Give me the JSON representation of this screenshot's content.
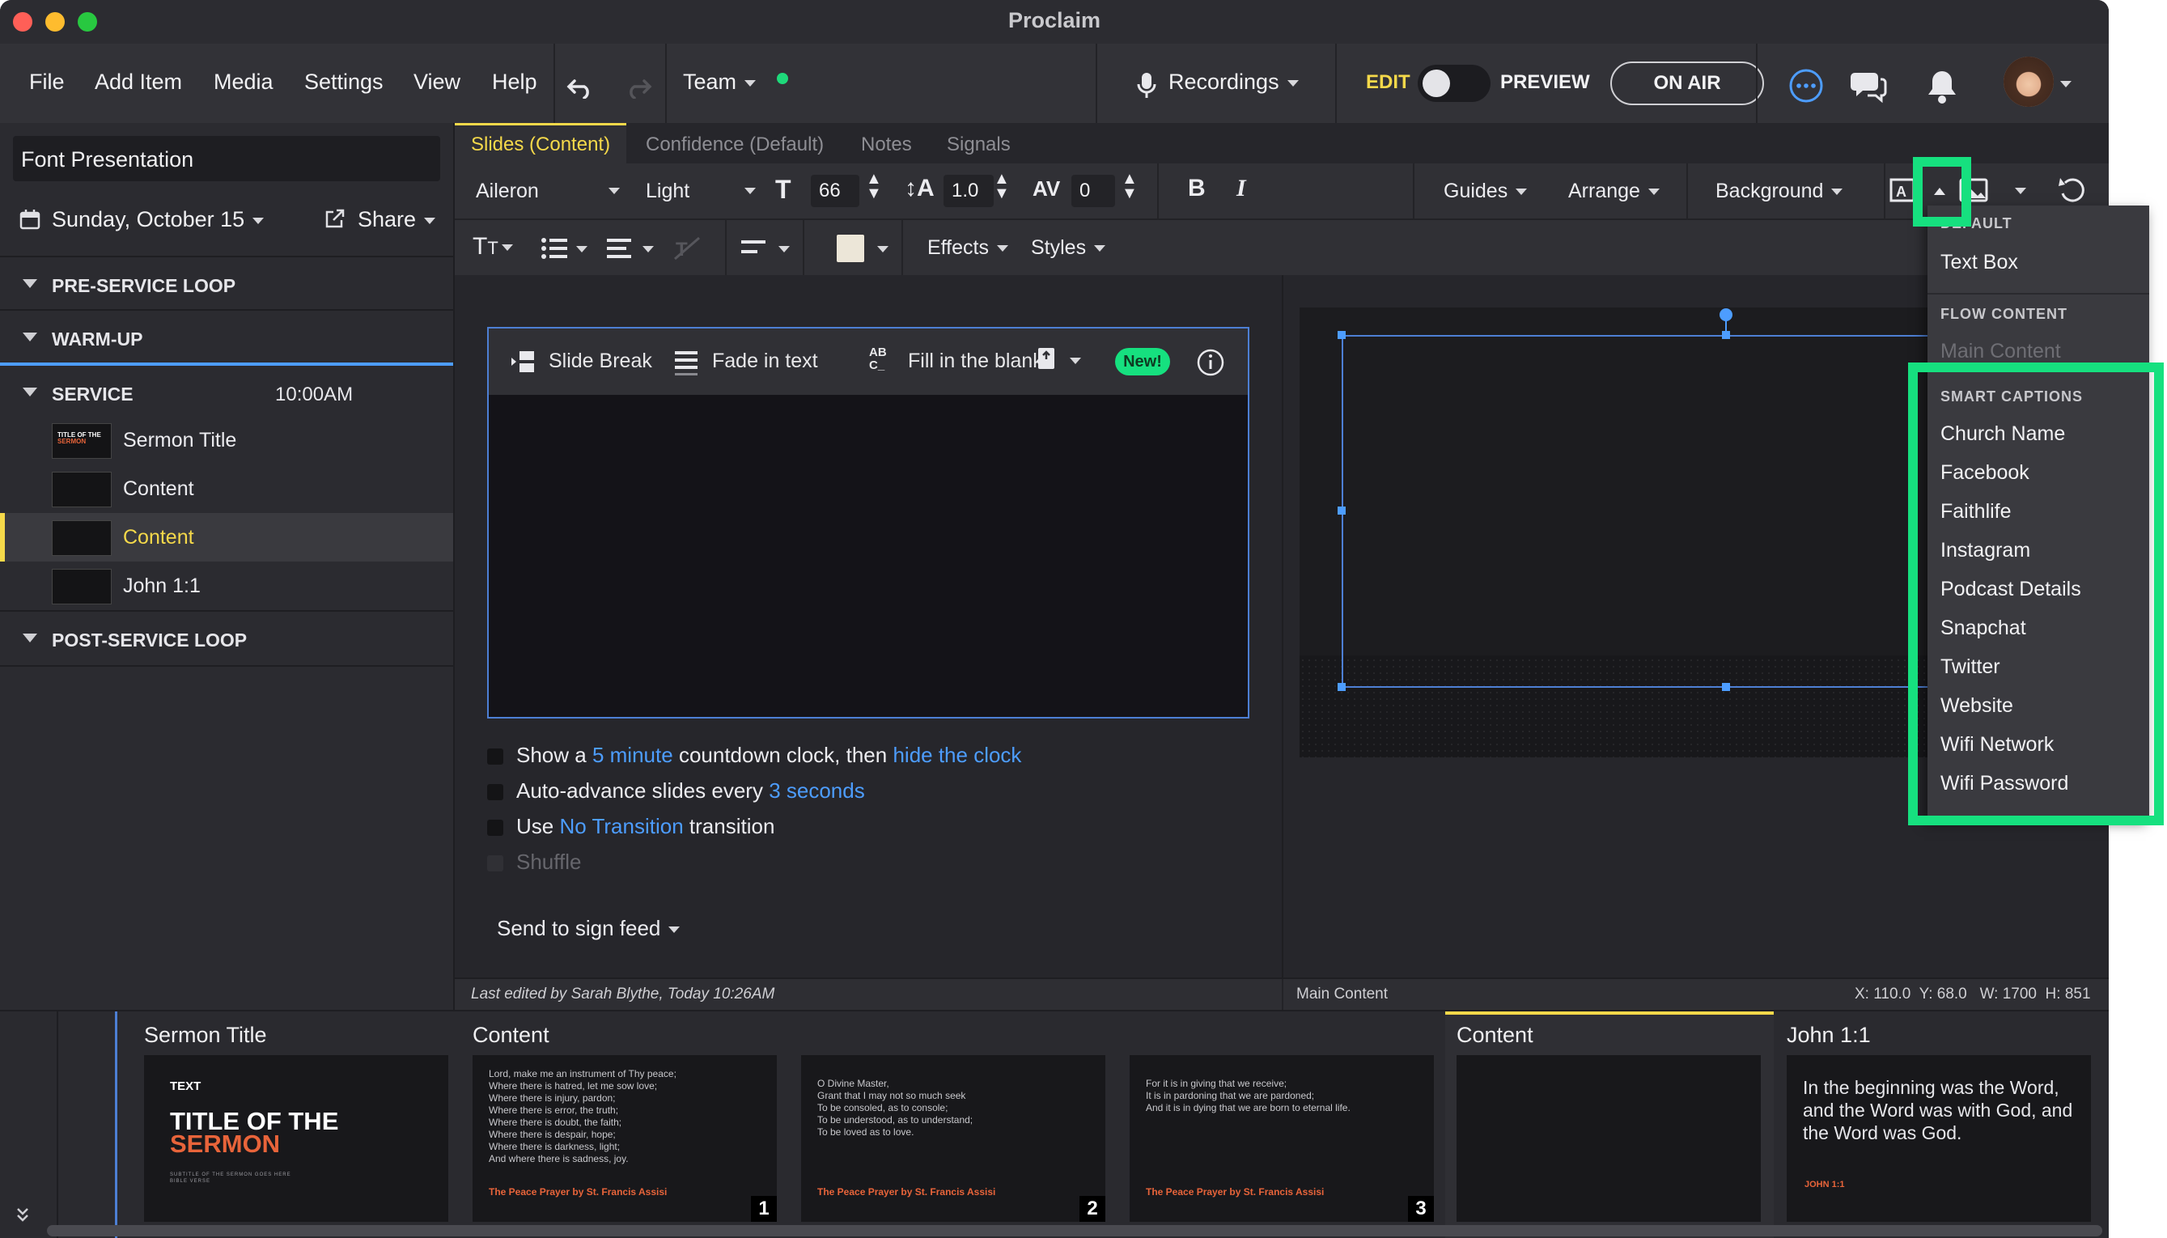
{
  "app": {
    "title": "Proclaim"
  },
  "menu": [
    "File",
    "Add Item",
    "Media",
    "Settings",
    "View",
    "Help"
  ],
  "header": {
    "team_label": "Team",
    "recordings_label": "Recordings",
    "edit_label": "EDIT",
    "preview_label": "PREVIEW",
    "on_air_label": "ON AIR"
  },
  "colors": {
    "accent": "#f5d94a",
    "link": "#4d9dff",
    "highlight": "#16e07f",
    "online": "#1ed97a",
    "sermon_orange": "#e8643a"
  },
  "sidebar": {
    "presentation_title": "Font Presentation",
    "date": "Sunday, October 15",
    "share_label": "Share",
    "sections": [
      {
        "label": "PRE-SERVICE LOOP"
      },
      {
        "label": "WARM-UP"
      },
      {
        "label": "SERVICE",
        "time": "10:00AM"
      },
      {
        "label": "POST-SERVICE LOOP"
      }
    ],
    "items": [
      {
        "label": "Sermon Title"
      },
      {
        "label": "Content"
      },
      {
        "label": "Content",
        "selected": true
      },
      {
        "label": "John 1:1"
      }
    ]
  },
  "tabs": [
    "Slides (Content)",
    "Confidence (Default)",
    "Notes",
    "Signals"
  ],
  "format": {
    "font": "Aileron",
    "weight": "Light",
    "size": "66",
    "line_height": "1.0",
    "spacing": "0",
    "bold": "B",
    "italic": "I",
    "guides": "Guides",
    "arrange": "Arrange",
    "background": "Background",
    "effects": "Effects",
    "styles": "Styles"
  },
  "editor": {
    "slide_break": "Slide Break",
    "fade_in_text": "Fade in text",
    "fill_blank": "Fill in the blank",
    "new_badge": "New!",
    "options": {
      "show_a": "Show a",
      "five_minute": "5 minute",
      "countdown": "countdown clock, then",
      "hide_clock": "hide the clock",
      "auto_advance": "Auto-advance slides every",
      "three_seconds": "3 seconds",
      "use": "Use",
      "no_transition": "No Transition",
      "transition": "transition",
      "shuffle": "Shuffle"
    },
    "send_to_sign": "Send to sign feed"
  },
  "status": {
    "last_edited": "Last edited by Sarah Blythe, Today 10:26AM",
    "layer": "Main Content",
    "coords": "X: 110.0  Y: 68.0   W: 1700  H: 851"
  },
  "dropdown": {
    "default_head": "DEFAULT",
    "default_items": [
      "Text Box"
    ],
    "flow_head": "FLOW CONTENT",
    "flow_items": [
      "Main Content"
    ],
    "smart_head": "SMART CAPTIONS",
    "smart_items": [
      "Church Name",
      "Facebook",
      "Faithlife",
      "Instagram",
      "Podcast Details",
      "Snapchat",
      "Twitter",
      "Website",
      "Wifi Network",
      "Wifi Password"
    ]
  },
  "strip": {
    "cards": [
      {
        "title": "Sermon Title",
        "small": "TEXT",
        "big1": "TITLE OF THE",
        "big2": "SERMON",
        "sub": "SUBTITLE OF THE SERMON GOES HERE\nBIBLE VERSE"
      },
      {
        "title": "Content",
        "text": "Lord, make me an instrument of Thy peace;\nWhere there is hatred, let me sow love;\nWhere there is injury, pardon;\nWhere there is error, the truth;\nWhere there is doubt, the faith;\nWhere there is despair, hope;\nWhere there is darkness, light;\nAnd where there is sadness, joy.",
        "foot": "The Peace Prayer by St. Francis Assisi",
        "badge": "1"
      },
      {
        "title": "",
        "text": "O Divine Master,\nGrant that I may not so much seek\nTo be consoled, as to console;\nTo be understood, as to understand;\nTo be loved as to love.",
        "foot": "The Peace Prayer by St. Francis Assisi",
        "badge": "2"
      },
      {
        "title": "",
        "text": "For it is in giving that we receive;\nIt is in pardoning that we are pardoned;\nAnd it is in dying that we are born to eternal life.",
        "foot": "The Peace Prayer by St. Francis Assisi",
        "badge": "3"
      },
      {
        "title": "Content"
      },
      {
        "title": "John 1:1",
        "text": "In the beginning was the Word,\nand the Word was with God, and\nthe Word was God.",
        "foot": "JOHN 1:1"
      }
    ]
  }
}
